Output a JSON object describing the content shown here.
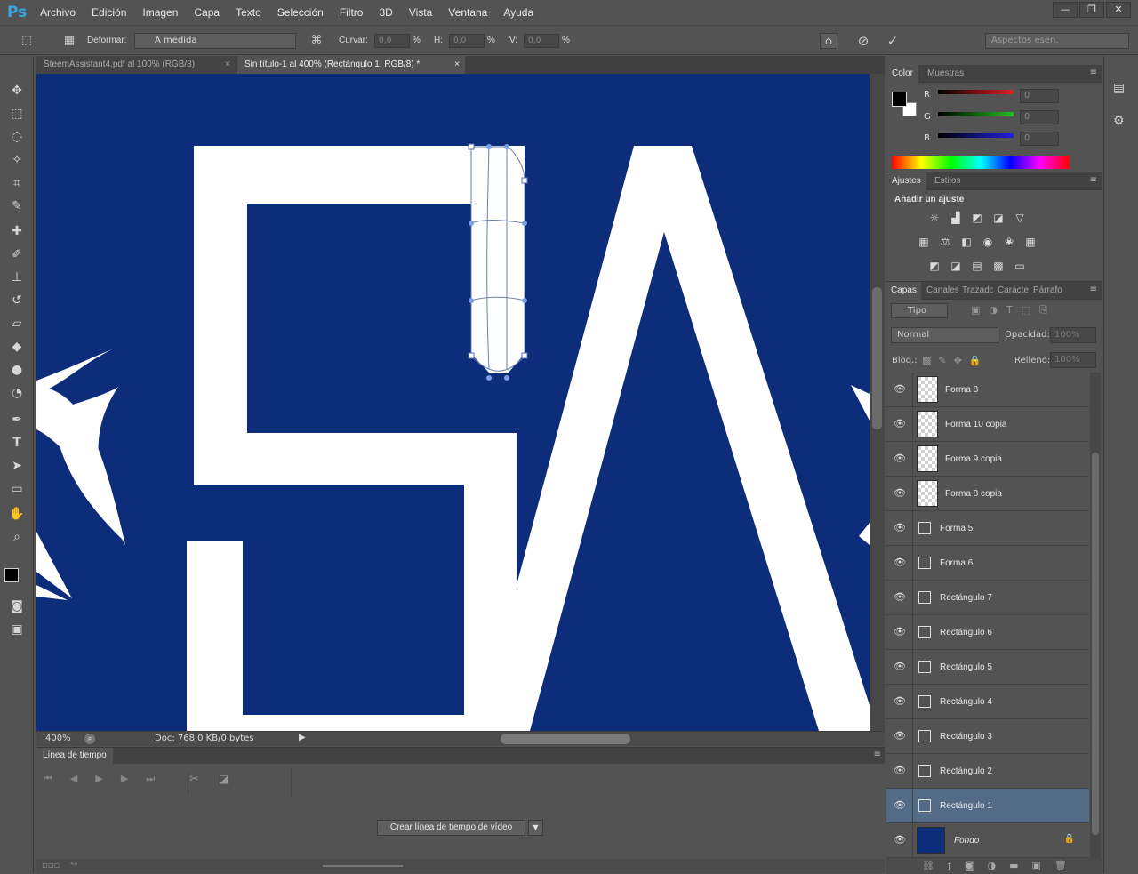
{
  "app": {
    "logo": "Ps"
  },
  "menu": [
    "Archivo",
    "Edición",
    "Imagen",
    "Capa",
    "Texto",
    "Selección",
    "Filtro",
    "3D",
    "Vista",
    "Ventana",
    "Ayuda"
  ],
  "window_controls": [
    "—",
    "❐",
    "✕"
  ],
  "options": {
    "deform_label": "Deformar:",
    "deform_value": "A medida",
    "curvar_label": "Curvar:",
    "curvar_value": "0,0",
    "h_label": "H:",
    "h_value": "0,0",
    "v_label": "V:",
    "v_value": "0,0",
    "percent": "%",
    "workspace": "Aspectos esen."
  },
  "tabs": [
    {
      "label": "SteemAssistant4.pdf al 100% (RGB/8)",
      "close": "×"
    },
    {
      "label": "Sin título-1 al 400% (Rectángulo 1, RGB/8) *",
      "close": "×"
    }
  ],
  "status": {
    "zoom": "400%",
    "doc": "Doc: 768,0 KB/0 bytes"
  },
  "timeline": {
    "title": "Línea de tiempo",
    "create_button": "Crear línea de tiempo de vídeo"
  },
  "color_panel": {
    "tabs": [
      "Color",
      "Muestras"
    ],
    "channels": [
      {
        "label": "R",
        "value": "0",
        "color": "#e02020"
      },
      {
        "label": "G",
        "value": "0",
        "color": "#20c020"
      },
      {
        "label": "B",
        "value": "0",
        "color": "#2020e0"
      }
    ]
  },
  "adjust_panel": {
    "tabs": [
      "Ajustes",
      "Estilos"
    ],
    "title": "Añadir un ajuste"
  },
  "layers_panel": {
    "tabs": [
      "Capas",
      "Canales",
      "Trazados",
      "Carácter",
      "Párrafo"
    ],
    "filter": "Tipo",
    "blend": "Normal",
    "opacity_label": "Opacidad:",
    "opacity": "100%",
    "lock_label": "Bloq.:",
    "fill_label": "Relleno:",
    "fill": "100%",
    "layers": [
      {
        "name": "Forma 8",
        "thumb": "checker"
      },
      {
        "name": "Forma 10 copia",
        "thumb": "checker"
      },
      {
        "name": "Forma 9 copia",
        "thumb": "checker"
      },
      {
        "name": "Forma 8 copia",
        "thumb": "checker"
      },
      {
        "name": "Forma 5",
        "thumb": "vector"
      },
      {
        "name": "Forma 6",
        "thumb": "vector"
      },
      {
        "name": "Rectángulo 7",
        "thumb": "vector"
      },
      {
        "name": "Rectángulo 6",
        "thumb": "vector"
      },
      {
        "name": "Rectángulo 5",
        "thumb": "vector"
      },
      {
        "name": "Rectángulo 4",
        "thumb": "vector"
      },
      {
        "name": "Rectángulo 3",
        "thumb": "vector"
      },
      {
        "name": "Rectángulo 2",
        "thumb": "vector"
      },
      {
        "name": "Rectángulo 1",
        "thumb": "vector",
        "selected": true
      },
      {
        "name": "Fondo",
        "thumb": "fill",
        "locked": true
      }
    ]
  },
  "colors": {
    "canvas_bg": "#0d2c7a",
    "selection": "#546b88",
    "accent": "#36a4e6"
  }
}
